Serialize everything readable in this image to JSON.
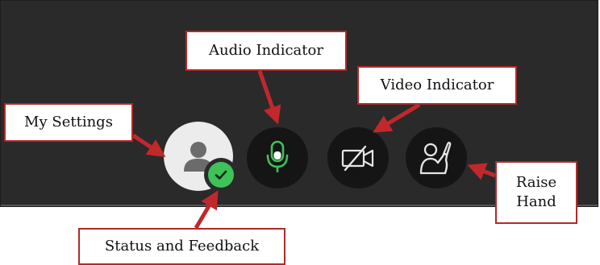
{
  "callouts": {
    "audio_indicator": "Audio Indicator",
    "video_indicator": "Video Indicator",
    "my_settings": "My Settings",
    "raise_hand": "Raise Hand",
    "status_and_feedback": "Status and Feedback"
  },
  "controls": {
    "my_settings_icon": "user-avatar-icon",
    "status_icon": "checkmark-icon",
    "audio_icon": "microphone-icon",
    "video_icon": "camera-off-icon",
    "hand_icon": "raise-hand-icon"
  },
  "colors": {
    "panel": "#2a2a2a",
    "callout_border": "#b02a2a",
    "arrow": "#c0282c",
    "status_green": "#3fc25a",
    "mic_green": "#3fc25a"
  }
}
